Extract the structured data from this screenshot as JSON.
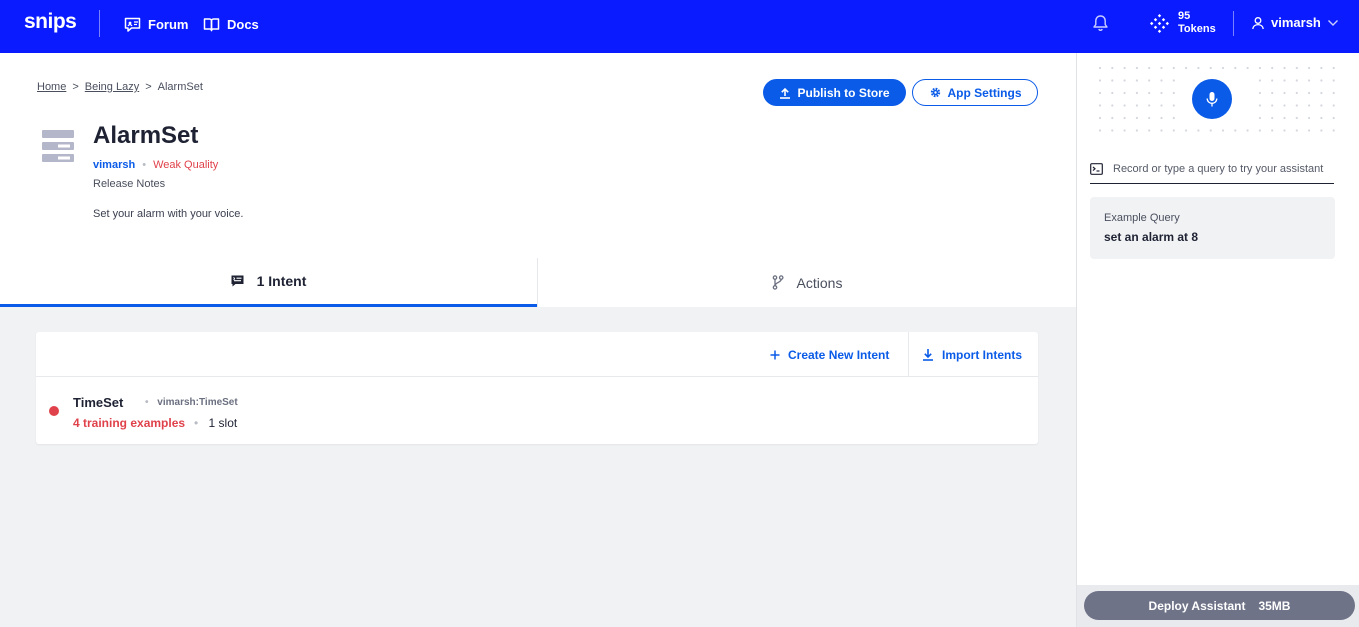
{
  "topbar": {
    "logo": "snips",
    "nav": [
      {
        "label": "Forum",
        "icon": "forum-icon"
      },
      {
        "label": "Docs",
        "icon": "book-icon"
      }
    ],
    "tokens_count": "95",
    "tokens_label": "Tokens",
    "username": "vimarsh"
  },
  "breadcrumb": [
    {
      "label": "Home"
    },
    {
      "label": "Being Lazy"
    },
    {
      "label": "AlarmSet"
    }
  ],
  "breadcrumb_separator": ">",
  "actions": {
    "publish_label": "Publish to Store",
    "settings_label": "App Settings"
  },
  "app": {
    "title": "AlarmSet",
    "author": "vimarsh",
    "quality": "Weak Quality",
    "release_notes": "Release Notes",
    "description": "Set your alarm with your voice."
  },
  "tabs": {
    "intents_label": "1 Intent",
    "actions_label": "Actions"
  },
  "intents_toolbar": {
    "create_label": "Create New Intent",
    "import_label": "Import Intents"
  },
  "intents": [
    {
      "name": "TimeSet",
      "id": "vimarsh:TimeSet",
      "examples": "4 training examples",
      "slots": "1 slot",
      "status_color": "#e0424b"
    }
  ],
  "meta_separator": "•",
  "assistant_panel": {
    "query_placeholder": "Record or type a query to try your assistant",
    "example_label": "Example Query",
    "example_text": "set an alarm at 8"
  },
  "deploy": {
    "label": "Deploy Assistant",
    "size": "35MB"
  },
  "colors": {
    "topbar": "#0a1bff",
    "accent": "#0a5be8",
    "error": "#e0424b",
    "deploy": "#6e7388"
  }
}
